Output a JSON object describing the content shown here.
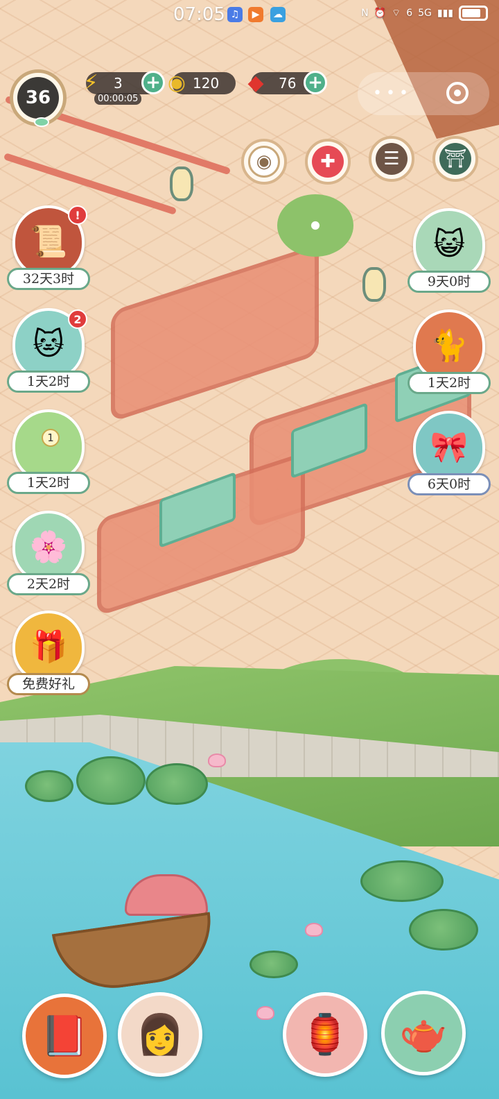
{
  "status_bar": {
    "time": "07:05",
    "network": "5G",
    "signal": "6"
  },
  "hud": {
    "level": "36",
    "energy": {
      "value": "3",
      "timer": "00:00:05"
    },
    "coins": {
      "value": "120"
    },
    "gems": {
      "value": "76"
    },
    "plus_symbol": "+"
  },
  "events_left": [
    {
      "label": "32天3时",
      "badge": "!",
      "icon": "book-scroll-icon"
    },
    {
      "label": "1天2时",
      "badge": "2",
      "icon": "cat-pond-icon"
    },
    {
      "label": "1天2时",
      "count": "1",
      "icon": "glass-orb-icon"
    },
    {
      "label": "2天2时",
      "icon": "flower-fairy-icon"
    },
    {
      "label": "免费好礼",
      "icon": "gift-knot-icon"
    }
  ],
  "events_right": [
    {
      "label": "9天0时",
      "icon": "cat-face-icon"
    },
    {
      "label": "1天2时",
      "icon": "cat-fan-icon"
    },
    {
      "label": "6天0时",
      "icon": "cat-giftbox-icon"
    }
  ],
  "colors": {
    "accent_green": "#4fb08a",
    "badge_red": "#e03c3c",
    "label_border": "#6aa88a"
  }
}
